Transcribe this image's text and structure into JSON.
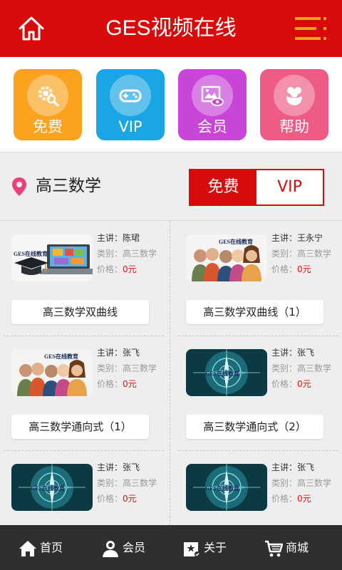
{
  "header": {
    "title": "GES视频在线",
    "home_icon": "home-icon",
    "menu_icon": "menu-icon"
  },
  "quick_links": [
    {
      "label": "免费",
      "color": "#fba21f",
      "icon": "gear-search-icon"
    },
    {
      "label": "VIP",
      "color": "#1aa6e4",
      "icon": "gamepad-icon"
    },
    {
      "label": "会员",
      "color": "#c845d8",
      "icon": "image-eye-icon"
    },
    {
      "label": "帮助",
      "color": "#ee5c83",
      "icon": "flower-icon"
    }
  ],
  "section": {
    "title": "高三数学",
    "icon": "location-pin-icon",
    "toggle_free": "免费",
    "toggle_vip": "VIP",
    "accent": "#d90a0a"
  },
  "labels": {
    "teacher_prefix": "主讲：",
    "category_prefix": "类别：",
    "price_prefix": "价格："
  },
  "courses": [
    {
      "teacher": "陈珺",
      "category": "高三数学",
      "price": "0元",
      "title": "高三数学双曲线",
      "thumb": "graduation-laptop",
      "logo": "GES在线教育"
    },
    {
      "teacher": "王永宁",
      "category": "高三数学",
      "price": "0元",
      "title": "高三数学双曲线（1）",
      "thumb": "students",
      "logo": "GES在线教育"
    },
    {
      "teacher": "张飞",
      "category": "高三数学",
      "price": "0元",
      "title": "高三数学通向式（1）",
      "thumb": "students",
      "logo": "GES在线教育"
    },
    {
      "teacher": "张飞",
      "category": "高三数学",
      "price": "0元",
      "title": "高三数学通向式（2）",
      "thumb": "compass",
      "logo": "GES在线教育"
    },
    {
      "teacher": "张飞",
      "category": "高三数学",
      "price": "0元",
      "title": "",
      "thumb": "compass",
      "logo": "GES在线教育"
    },
    {
      "teacher": "张飞",
      "category": "高三数学",
      "price": "0元",
      "title": "",
      "thumb": "compass",
      "logo": "GES在线教育"
    }
  ],
  "bottom_nav": [
    {
      "label": "首页",
      "icon": "home-icon"
    },
    {
      "label": "会员",
      "icon": "user-icon"
    },
    {
      "label": "关于",
      "icon": "about-icon"
    },
    {
      "label": "商城",
      "icon": "cart-icon"
    }
  ]
}
